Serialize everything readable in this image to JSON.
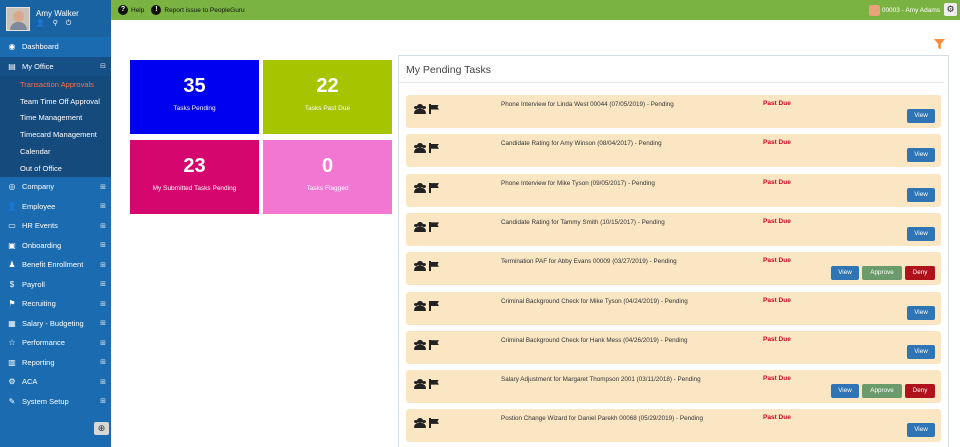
{
  "profile": {
    "name": "Amy Walker",
    "icons": "👤 ⚲ ⏻"
  },
  "sidebar": {
    "items": [
      {
        "label": "Dashboard",
        "icon": "dashboard-icon",
        "glyph": "◉"
      },
      {
        "label": "My Office",
        "icon": "office-icon",
        "glyph": "▤",
        "exp": "⊟"
      },
      {
        "label": "Company",
        "icon": "globe-icon",
        "glyph": "◎",
        "exp": "⊞"
      },
      {
        "label": "Employee",
        "icon": "user-icon",
        "glyph": "👤",
        "exp": "⊞"
      },
      {
        "label": "HR Events",
        "icon": "folder-icon",
        "glyph": "▭",
        "exp": "⊞"
      },
      {
        "label": "Onboarding",
        "icon": "briefcase-icon",
        "glyph": "▣",
        "exp": "⊞"
      },
      {
        "label": "Benefit Enrollment",
        "icon": "benefit-icon",
        "glyph": "♟",
        "exp": "⊞"
      },
      {
        "label": "Payroll",
        "icon": "dollar-icon",
        "glyph": "$",
        "exp": "⊞"
      },
      {
        "label": "Recruiting",
        "icon": "recruiting-icon",
        "glyph": "⚑",
        "exp": "⊞"
      },
      {
        "label": "Salary - Budgeting",
        "icon": "money-icon",
        "glyph": "▦",
        "exp": "⊞"
      },
      {
        "label": "Performance",
        "icon": "star-icon",
        "glyph": "☆",
        "exp": "⊞"
      },
      {
        "label": "Reporting",
        "icon": "print-icon",
        "glyph": "▥",
        "exp": "⊞"
      },
      {
        "label": "ACA",
        "icon": "cogs-icon",
        "glyph": "⚙",
        "exp": "⊞"
      },
      {
        "label": "System Setup",
        "icon": "wrench-icon",
        "glyph": "✎",
        "exp": "⊞"
      }
    ],
    "sub_items": [
      "Transaction Approvals",
      "Team Time Off Approval",
      "Time Management",
      "Timecard Management",
      "Calendar",
      "Out of Office"
    ],
    "collapse_glyph": "⊕"
  },
  "topbar": {
    "help": "Help",
    "report": "Report issue to PeopleGuru",
    "user": "00003 - Amy Adams"
  },
  "tiles": [
    {
      "value": "35",
      "label": "Tasks Pending",
      "color": "#0000f0"
    },
    {
      "value": "22",
      "label": "Tasks Past Due",
      "color": "#a6c400"
    },
    {
      "value": "23",
      "label": "My Submitted Tasks Pending",
      "color": "#d6066f"
    },
    {
      "value": "0",
      "label": "Tasks Flagged",
      "color": "#f277d3"
    }
  ],
  "panel": {
    "title": "My Pending Tasks",
    "status_label": "Past Due",
    "view_label": "View",
    "approve_label": "Approve",
    "deny_label": "Deny",
    "tasks": [
      {
        "desc": "Phone Interview for Linda West 00044 (07/05/2019) - Pending",
        "actions": false
      },
      {
        "desc": "Candidate Rating for Amy Winson (08/04/2017) - Pending",
        "actions": false
      },
      {
        "desc": "Phone Interview for Mike Tyson (09/05/2017) - Pending",
        "actions": false
      },
      {
        "desc": "Candidate Rating for Tammy Smith (10/15/2017) - Pending",
        "actions": false
      },
      {
        "desc": "Termination PAF for Abby Evans 00009 (03/27/2019) - Pending",
        "actions": true
      },
      {
        "desc": "Criminal Background Check for Mike Tyson (04/24/2019) - Pending",
        "actions": false
      },
      {
        "desc": "Criminal Background Check for Hank Mess (04/26/2019) - Pending",
        "actions": false
      },
      {
        "desc": "Salary Adjustment for Margaret Thompson 2001 (03/11/2018) - Pending",
        "actions": true
      },
      {
        "desc": "Postion Change Wizard for Daniel Parekh 00068 (05/29/2019) - Pending",
        "actions": false
      }
    ]
  }
}
